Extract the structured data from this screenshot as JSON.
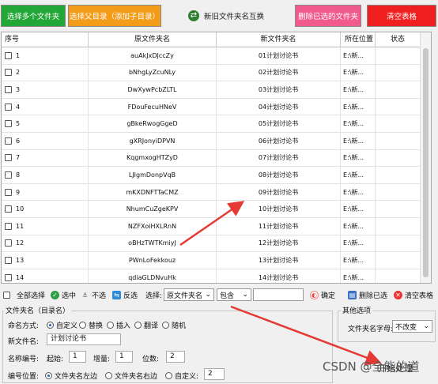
{
  "toolbar": {
    "select_files": "选择多个文件夹",
    "select_parent": "选择父目录（添加子目录）",
    "swap_names": "新旧文件夹名互换",
    "delete_selected": "删除已选的文件夹",
    "clear_table": "清空表格"
  },
  "table": {
    "headers": [
      "序号",
      "原文件夹名",
      "新文件夹名",
      "所在位置",
      "状态"
    ],
    "rows": [
      {
        "no": "1",
        "orig": "auAkJxDJccZy",
        "new": "01计划讨论书",
        "loc": "E:\\新...",
        "status": ""
      },
      {
        "no": "2",
        "orig": "bNhgLyZcuNLy",
        "new": "02计划讨论书",
        "loc": "E:\\新...",
        "status": ""
      },
      {
        "no": "3",
        "orig": "DwXywPcbZLTL",
        "new": "03计划讨论书",
        "loc": "E:\\新...",
        "status": ""
      },
      {
        "no": "4",
        "orig": "FDouFecuHNeV",
        "new": "04计划讨论书",
        "loc": "E:\\新...",
        "status": ""
      },
      {
        "no": "5",
        "orig": "gBkeRwogGgeD",
        "new": "05计划讨论书",
        "loc": "E:\\新...",
        "status": ""
      },
      {
        "no": "6",
        "orig": "gXRJonyiDPVN",
        "new": "06计划讨论书",
        "loc": "E:\\新...",
        "status": ""
      },
      {
        "no": "7",
        "orig": "KqgmxogHTZyD",
        "new": "07计划讨论书",
        "loc": "E:\\新...",
        "status": ""
      },
      {
        "no": "8",
        "orig": "LJIgmDonpVqB",
        "new": "08计划讨论书",
        "loc": "E:\\新...",
        "status": ""
      },
      {
        "no": "9",
        "orig": "mKXDNFTTaCMZ",
        "new": "09计划讨论书",
        "loc": "E:\\新...",
        "status": ""
      },
      {
        "no": "10",
        "orig": "NhumCuZgeKPV",
        "new": "10计划讨论书",
        "loc": "E:\\新...",
        "status": ""
      },
      {
        "no": "11",
        "orig": "NZFXoiHXLRnN",
        "new": "11计划讨论书",
        "loc": "E:\\新...",
        "status": ""
      },
      {
        "no": "12",
        "orig": "oBHzTWTKmiyJ",
        "new": "12计划讨论书",
        "loc": "E:\\新...",
        "status": ""
      },
      {
        "no": "13",
        "orig": "PWnLoFekkouz",
        "new": "13计划讨论书",
        "loc": "E:\\新...",
        "status": ""
      },
      {
        "no": "14",
        "orig": "qdiaGLDNvuHk",
        "new": "14计划讨论书",
        "loc": "E:\\新...",
        "status": ""
      }
    ]
  },
  "selection": {
    "select_all": "全部选择",
    "select": "选中",
    "deselect": "不选",
    "invert": "反选",
    "choose_label": "选择:",
    "field_value": "原文件夹名",
    "match_value": "包含",
    "confirm": "确定",
    "delete_selected": "删除已选",
    "clear_table": "清空表格"
  },
  "settings": {
    "group_label": "文件夹名（目录名）",
    "naming_mode_label": "命名方式:",
    "modes": [
      "自定义",
      "替换",
      "插入",
      "翻译",
      "随机"
    ],
    "selected_mode": "自定义",
    "new_name_label": "新文件名:",
    "new_name_value": "计划讨论书",
    "numbering_label": "名称编号:",
    "start_label": "起始:",
    "start_value": "1",
    "increment_label": "增量:",
    "increment_value": "1",
    "digits_label": "位数:",
    "digits_value": "2",
    "position_label": "编号位置:",
    "positions": [
      "文件夹名左边",
      "文件夹名右边",
      "自定义:"
    ],
    "selected_position": "文件夹名左边",
    "custom_position_value": "2"
  },
  "other": {
    "group_label": "其他选项",
    "case_label": "文件夹名字母:",
    "case_value": "不改变"
  },
  "start_button": "开始处理",
  "watermark": "CSDN @全能的道"
}
